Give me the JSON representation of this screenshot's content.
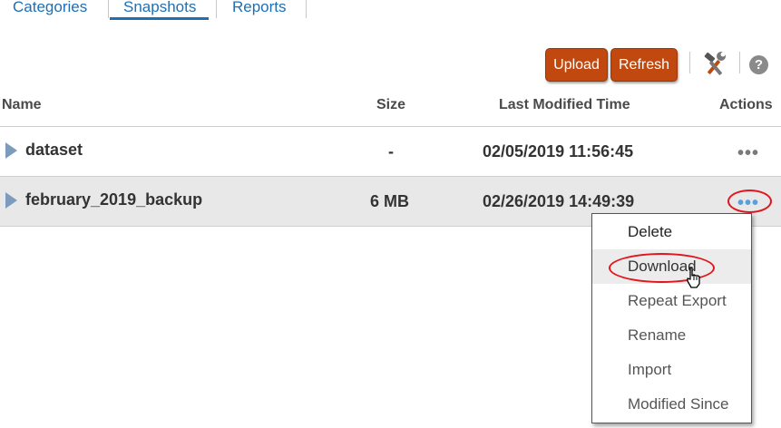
{
  "tabs": [
    {
      "label": "Categories"
    },
    {
      "label": "Snapshots"
    },
    {
      "label": "Reports"
    }
  ],
  "toolbar": {
    "upload_label": "Upload",
    "refresh_label": "Refresh",
    "tools_icon": "tools-icon",
    "help_icon": "help-icon",
    "help_glyph": "?"
  },
  "table": {
    "columns": [
      "Name",
      "Size",
      "Last Modified Time",
      "Actions"
    ],
    "rows": [
      {
        "name": "dataset",
        "size": "-",
        "modified": "02/05/2019 11:56:45",
        "actions": "•••"
      },
      {
        "name": "february_2019_backup",
        "size": "6 MB",
        "modified": "02/26/2019 14:49:39",
        "actions": "•••"
      }
    ]
  },
  "menu": {
    "items": [
      "Delete",
      "Download",
      "Repeat Export",
      "Rename",
      "Import",
      "Modified Since"
    ]
  },
  "colors": {
    "accent": "#1f6fb5",
    "button": "#c1490f",
    "highlight_ring": "#e0161f",
    "selected_row": "#e8e8e8"
  }
}
